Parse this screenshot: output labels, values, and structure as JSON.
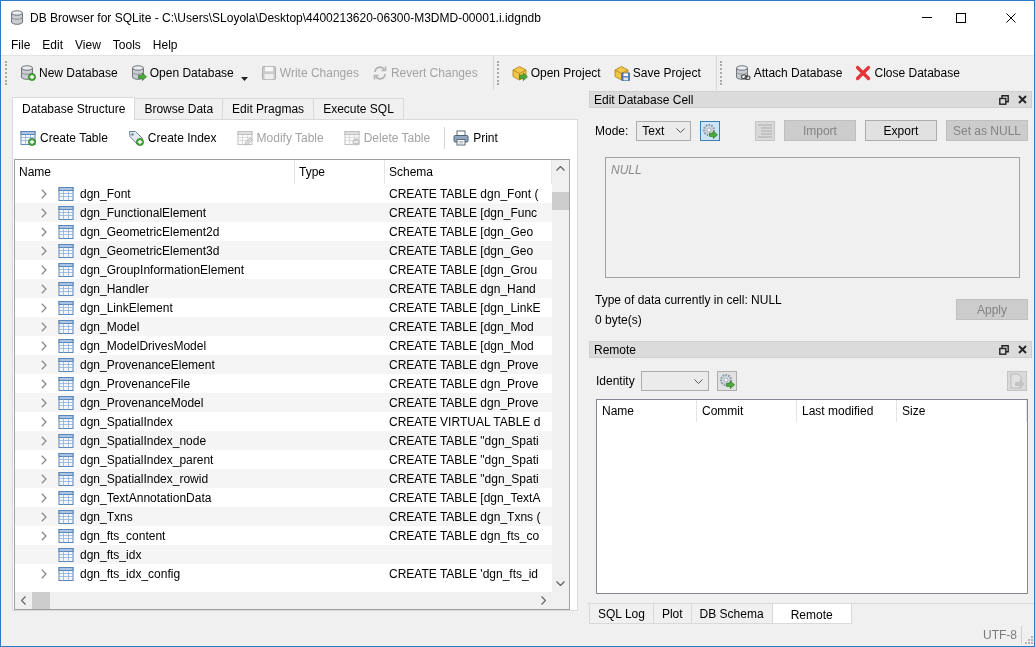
{
  "window": {
    "title": "DB Browser for SQLite - C:\\Users\\SLoyola\\Desktop\\4400213620-06300-M3DMD-00001.i.idgndb"
  },
  "menu": [
    "File",
    "Edit",
    "View",
    "Tools",
    "Help"
  ],
  "toolbar": [
    [
      {
        "label": "New Database",
        "disabled": false,
        "dropdown": false
      },
      {
        "label": "Open Database",
        "disabled": false,
        "dropdown": true
      },
      {
        "label": "Write Changes",
        "disabled": true,
        "dropdown": false
      },
      {
        "label": "Revert Changes",
        "disabled": true,
        "dropdown": false
      }
    ],
    [
      {
        "label": "Open Project",
        "disabled": false,
        "dropdown": false
      },
      {
        "label": "Save Project",
        "disabled": false,
        "dropdown": false
      }
    ],
    [
      {
        "label": "Attach Database",
        "disabled": false,
        "dropdown": false
      },
      {
        "label": "Close Database",
        "disabled": false,
        "dropdown": false
      }
    ]
  ],
  "main_tabs": [
    {
      "label": "Database Structure",
      "selected": true
    },
    {
      "label": "Browse Data",
      "selected": false
    },
    {
      "label": "Edit Pragmas",
      "selected": false
    },
    {
      "label": "Execute SQL",
      "selected": false
    }
  ],
  "structure_toolbar": [
    [
      {
        "label": "Create Table",
        "disabled": false
      },
      {
        "label": "Create Index",
        "disabled": false
      },
      {
        "label": "Modify Table",
        "disabled": true
      },
      {
        "label": "Delete Table",
        "disabled": true
      }
    ],
    [
      {
        "label": "Print",
        "disabled": false
      }
    ]
  ],
  "tree": {
    "columns": [
      "Name",
      "Type",
      "Schema"
    ],
    "rows": [
      {
        "name": "dgn_Font",
        "schema": "CREATE TABLE dgn_Font (",
        "expandable": true
      },
      {
        "name": "dgn_FunctionalElement",
        "schema": "CREATE TABLE [dgn_Func",
        "expandable": true
      },
      {
        "name": "dgn_GeometricElement2d",
        "schema": "CREATE TABLE [dgn_Geo",
        "expandable": true
      },
      {
        "name": "dgn_GeometricElement3d",
        "schema": "CREATE TABLE [dgn_Geo",
        "expandable": true
      },
      {
        "name": "dgn_GroupInformationElement",
        "schema": "CREATE TABLE [dgn_Grou",
        "expandable": true
      },
      {
        "name": "dgn_Handler",
        "schema": "CREATE TABLE dgn_Hand",
        "expandable": true
      },
      {
        "name": "dgn_LinkElement",
        "schema": "CREATE TABLE [dgn_LinkE",
        "expandable": true
      },
      {
        "name": "dgn_Model",
        "schema": "CREATE TABLE [dgn_Mod",
        "expandable": true
      },
      {
        "name": "dgn_ModelDrivesModel",
        "schema": "CREATE TABLE [dgn_Mod",
        "expandable": true
      },
      {
        "name": "dgn_ProvenanceElement",
        "schema": "CREATE TABLE dgn_Prove",
        "expandable": true
      },
      {
        "name": "dgn_ProvenanceFile",
        "schema": "CREATE TABLE dgn_Prove",
        "expandable": true
      },
      {
        "name": "dgn_ProvenanceModel",
        "schema": "CREATE TABLE dgn_Prove",
        "expandable": true
      },
      {
        "name": "dgn_SpatialIndex",
        "schema": "CREATE VIRTUAL TABLE d",
        "expandable": true
      },
      {
        "name": "dgn_SpatialIndex_node",
        "schema": "CREATE TABLE \"dgn_Spati",
        "expandable": true
      },
      {
        "name": "dgn_SpatialIndex_parent",
        "schema": "CREATE TABLE \"dgn_Spati",
        "expandable": true
      },
      {
        "name": "dgn_SpatialIndex_rowid",
        "schema": "CREATE TABLE \"dgn_Spati",
        "expandable": true
      },
      {
        "name": "dgn_TextAnnotationData",
        "schema": "CREATE TABLE [dgn_TextA",
        "expandable": true
      },
      {
        "name": "dgn_Txns",
        "schema": "CREATE TABLE dgn_Txns (",
        "expandable": true
      },
      {
        "name": "dgn_fts_content",
        "schema": "CREATE TABLE dgn_fts_co",
        "expandable": true
      },
      {
        "name": "dgn_fts_idx",
        "expandable": false
      },
      {
        "name": "dgn_fts_idx_config",
        "schema": "CREATE TABLE 'dgn_fts_id",
        "expandable": true
      }
    ]
  },
  "edit_cell": {
    "title": "Edit Database Cell",
    "mode_label": "Mode:",
    "mode": "Text",
    "auto_switch": {
      "checked": true
    },
    "word_wrap": {
      "disabled": true
    },
    "buttons": [
      {
        "label": "Import",
        "disabled": true
      },
      {
        "label": "Export",
        "disabled": false
      },
      {
        "label": "Set as NULL",
        "disabled": true
      }
    ],
    "editor": {
      "placeholder": "NULL"
    },
    "type_info": "Type of data currently in cell: NULL",
    "size_info": "0 byte(s)",
    "apply": {
      "label": "Apply",
      "disabled": true
    }
  },
  "remote": {
    "title": "Remote",
    "identity_label": "Identity",
    "upload_button": {
      "disabled": true
    },
    "columns": [
      "Name",
      "Commit",
      "Last modified",
      "Size"
    ]
  },
  "bottom_tabs": [
    {
      "label": "SQL Log",
      "selected": false
    },
    {
      "label": "Plot",
      "selected": false
    },
    {
      "label": "DB Schema",
      "selected": false
    },
    {
      "label": "Remote",
      "selected": true
    }
  ],
  "status_bar": {
    "encoding": "UTF-8"
  }
}
